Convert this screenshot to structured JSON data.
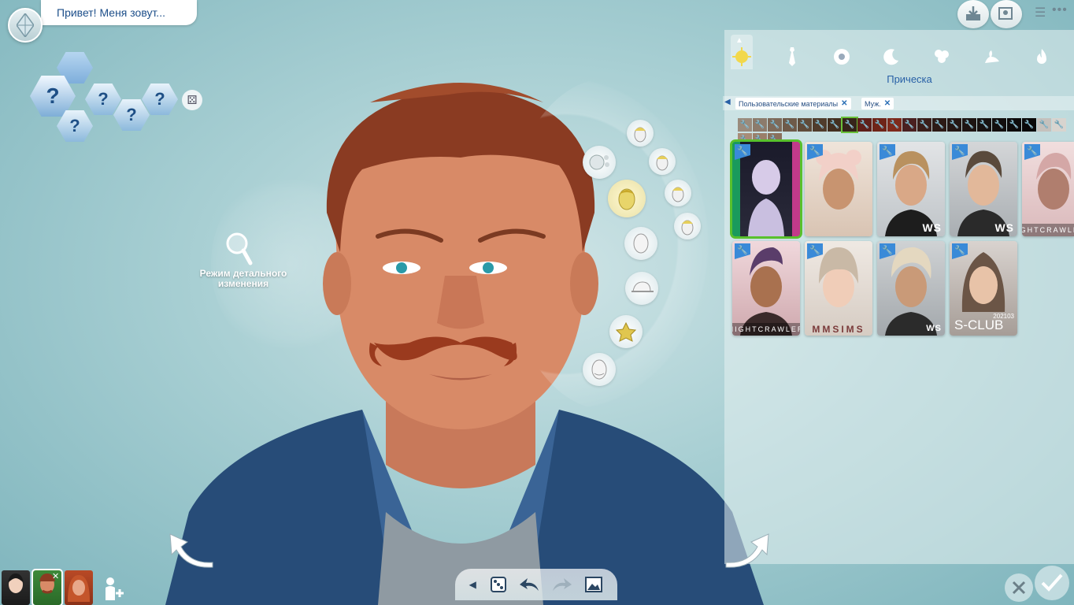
{
  "header": {
    "name_prompt": "Привет! Меня зовут..."
  },
  "traits": {
    "unknown_symbol": "?"
  },
  "detail_mode": {
    "label": "Режим детального изменения"
  },
  "panel": {
    "category_title": "Прическа",
    "filters": [
      {
        "label": "Пользовательские материалы",
        "remove": "✕"
      },
      {
        "label": "Муж.",
        "remove": "✕"
      }
    ],
    "tiles": [
      {
        "mark": "",
        "band": ""
      },
      {
        "mark": "",
        "band": ""
      },
      {
        "mark": "WS",
        "band": ""
      },
      {
        "mark": "WS",
        "band": ""
      },
      {
        "mark": "",
        "band": "NIGHTCRAWLER"
      },
      {
        "mark": "",
        "band": "NIGHTCRAWLER"
      },
      {
        "mark": "",
        "band": "MMSIMS"
      },
      {
        "mark": "WS",
        "band": ""
      },
      {
        "mark": "S-CLUB",
        "band": "",
        "sub": "202103"
      }
    ]
  },
  "icons": {
    "plumbob": "plumbob-icon",
    "detail": "magnifier-icon",
    "categories": [
      "head-icon",
      "tie-icon",
      "ball-icon",
      "sleep-icon",
      "party-icon",
      "swim-icon",
      "fire-icon"
    ]
  },
  "colors": {
    "accent": "#2860a6",
    "badge": "#3a8ad8",
    "hair": "#8a3b22",
    "jacket": "#274c78"
  }
}
